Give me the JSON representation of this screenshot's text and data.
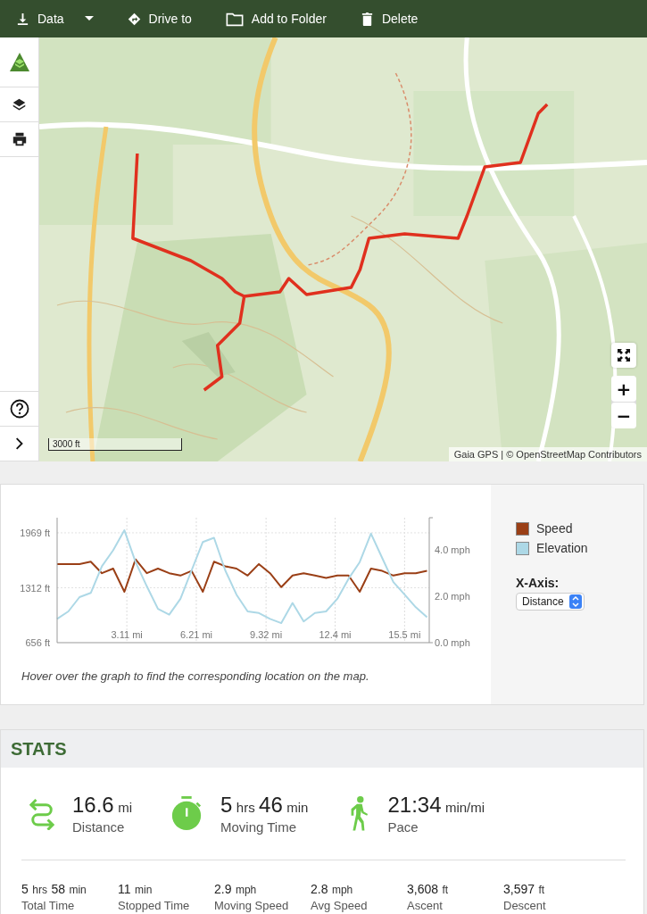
{
  "toolbar": {
    "items": [
      {
        "label": "Data",
        "dropdown": true
      },
      {
        "label": "Drive to",
        "dropdown": false
      },
      {
        "label": "Add to Folder",
        "dropdown": false
      },
      {
        "label": "Delete",
        "dropdown": false
      }
    ]
  },
  "map": {
    "zoom_in": "+",
    "zoom_out": "−",
    "scale": "3000 ft",
    "attribution": "Gaia GPS | © OpenStreetMap Contributors"
  },
  "elevation_chart": {
    "chart_data": {
      "type": "line",
      "grid": true,
      "xlim": [
        0,
        16.6
      ],
      "ylim": [
        656,
        2150
      ],
      "y2lim": [
        0,
        5.4
      ],
      "xticks": [
        {
          "value": 3.11,
          "label": "3.11 mi"
        },
        {
          "value": 6.21,
          "label": "6.21 mi"
        },
        {
          "value": 9.32,
          "label": "9.32 mi"
        },
        {
          "value": 12.4,
          "label": "12.4 mi"
        },
        {
          "value": 15.5,
          "label": "15.5 mi"
        }
      ],
      "yticks": [
        {
          "value": 656,
          "label": "656 ft"
        },
        {
          "value": 1312,
          "label": "1312 ft"
        },
        {
          "value": 1969,
          "label": "1969 ft"
        }
      ],
      "y2ticks": [
        {
          "value": 0,
          "label": "0.0 mph"
        },
        {
          "value": 2,
          "label": "2.0 mph"
        },
        {
          "value": 4,
          "label": "4.0 mph"
        }
      ],
      "x": [
        0,
        0.5,
        1,
        1.5,
        2,
        2.5,
        3,
        3.5,
        4,
        4.5,
        5,
        5.5,
        6,
        6.5,
        7,
        7.5,
        8,
        8.5,
        9,
        9.5,
        10,
        10.5,
        11,
        11.5,
        12,
        12.5,
        13,
        13.5,
        14,
        14.5,
        15,
        15.5,
        16,
        16.5
      ],
      "series": [
        {
          "name": "Speed",
          "color": "#9a3f16",
          "axis": "y2",
          "values": [
            3.4,
            3.4,
            3.4,
            3.5,
            3.0,
            3.2,
            2.2,
            3.6,
            3.0,
            3.2,
            3.0,
            2.9,
            3.1,
            2.2,
            3.5,
            3.3,
            3.2,
            2.9,
            3.4,
            3.0,
            2.4,
            2.9,
            3.0,
            2.9,
            2.8,
            2.9,
            2.9,
            2.2,
            3.2,
            3.1,
            2.9,
            3.0,
            3.0,
            3.1
          ]
        },
        {
          "name": "Elevation",
          "color": "#add8e6",
          "values": [
            940,
            1030,
            1200,
            1250,
            1570,
            1760,
            2000,
            1620,
            1330,
            1060,
            990,
            1180,
            1520,
            1860,
            1910,
            1520,
            1230,
            1030,
            1010,
            940,
            890,
            1130,
            910,
            1010,
            1030,
            1180,
            1420,
            1620,
            1960,
            1670,
            1380,
            1230,
            1080,
            960
          ]
        }
      ]
    },
    "x_axis_label": "X-Axis:",
    "x_axis_value": "Distance",
    "hint": "Hover over the graph to find the corresponding location on the map."
  },
  "stats": {
    "title": "STATS",
    "major": [
      {
        "parts": [
          {
            "num": "16.6",
            "unit": "mi"
          }
        ],
        "label": "Distance"
      },
      {
        "parts": [
          {
            "num": "5",
            "unit": "hrs"
          },
          {
            "num": "46",
            "unit": "min"
          }
        ],
        "label": "Moving Time"
      },
      {
        "parts": [
          {
            "num": "21:34",
            "unit": "min/mi"
          }
        ],
        "label": "Pace"
      }
    ],
    "minor": [
      {
        "parts": [
          {
            "num": "5",
            "unit": "hrs"
          },
          {
            "num": "58",
            "unit": "min"
          }
        ],
        "label": "Total Time"
      },
      {
        "parts": [
          {
            "num": "11",
            "unit": "min"
          }
        ],
        "label": "Stopped Time"
      },
      {
        "parts": [
          {
            "num": "2.9",
            "unit": "mph"
          }
        ],
        "label": "Moving Speed"
      },
      {
        "parts": [
          {
            "num": "2.8",
            "unit": "mph"
          }
        ],
        "label": "Avg Speed"
      },
      {
        "parts": [
          {
            "num": "3,608",
            "unit": "ft"
          }
        ],
        "label": "Ascent"
      },
      {
        "parts": [
          {
            "num": "3,597",
            "unit": "ft"
          }
        ],
        "label": "Descent"
      }
    ]
  }
}
